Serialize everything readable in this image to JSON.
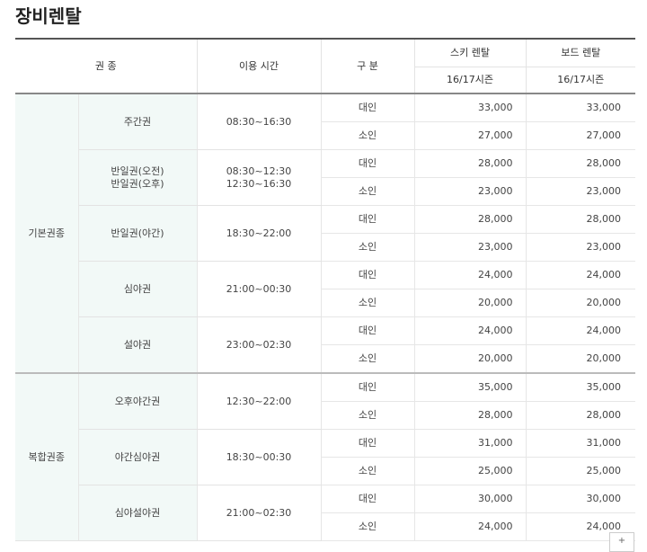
{
  "page": {
    "title": "장비렌탈"
  },
  "table": {
    "headers": {
      "ticket_type": "권 종",
      "usage_time": "이용 시간",
      "division": "구 분",
      "ski_rental": "스키 렌탈",
      "board_rental": "보드 렌탈",
      "ski_season": "16/17시즌",
      "board_season": "16/17시즌"
    },
    "categories": {
      "basic": "기본권종",
      "combo": "복합권종"
    },
    "tickets": [
      {
        "name": "주간권",
        "time": "08:30~16:30",
        "adult": {
          "label": "대인",
          "ski": "33,000",
          "board": "33,000"
        },
        "child": {
          "label": "소인",
          "ski": "27,000",
          "board": "27,000"
        }
      },
      {
        "name": "반일권(오전)",
        "name2": "반일권(오후)",
        "time": "08:30~12:30",
        "time2": "12:30~16:30",
        "adult": {
          "label": "대인",
          "ski": "28,000",
          "board": "28,000"
        },
        "child": {
          "label": "소인",
          "ski": "23,000",
          "board": "23,000"
        }
      },
      {
        "name": "반일권(야간)",
        "time": "18:30~22:00",
        "adult": {
          "label": "대인",
          "ski": "28,000",
          "board": "28,000"
        },
        "child": {
          "label": "소인",
          "ski": "23,000",
          "board": "23,000"
        }
      },
      {
        "name": "심야권",
        "time": "21:00~00:30",
        "adult": {
          "label": "대인",
          "ski": "24,000",
          "board": "24,000"
        },
        "child": {
          "label": "소인",
          "ski": "20,000",
          "board": "20,000"
        }
      },
      {
        "name": "설야권",
        "time": "23:00~02:30",
        "adult": {
          "label": "대인",
          "ski": "24,000",
          "board": "24,000"
        },
        "child": {
          "label": "소인",
          "ski": "20,000",
          "board": "20,000"
        }
      },
      {
        "name": "오후야간권",
        "time": "12:30~22:00",
        "adult": {
          "label": "대인",
          "ski": "35,000",
          "board": "35,000"
        },
        "child": {
          "label": "소인",
          "ski": "28,000",
          "board": "28,000"
        }
      },
      {
        "name": "야간심야권",
        "time": "18:30~00:30",
        "adult": {
          "label": "대인",
          "ski": "31,000",
          "board": "31,000"
        },
        "child": {
          "label": "소인",
          "ski": "25,000",
          "board": "25,000"
        }
      },
      {
        "name": "심야설야권",
        "time": "21:00~02:30",
        "adult": {
          "label": "대인",
          "ski": "30,000",
          "board": "30,000"
        },
        "child": {
          "label": "소인",
          "ski": "24,000",
          "board": "24,000"
        }
      }
    ]
  },
  "controls": {
    "scroll_top_glyph": "+"
  }
}
